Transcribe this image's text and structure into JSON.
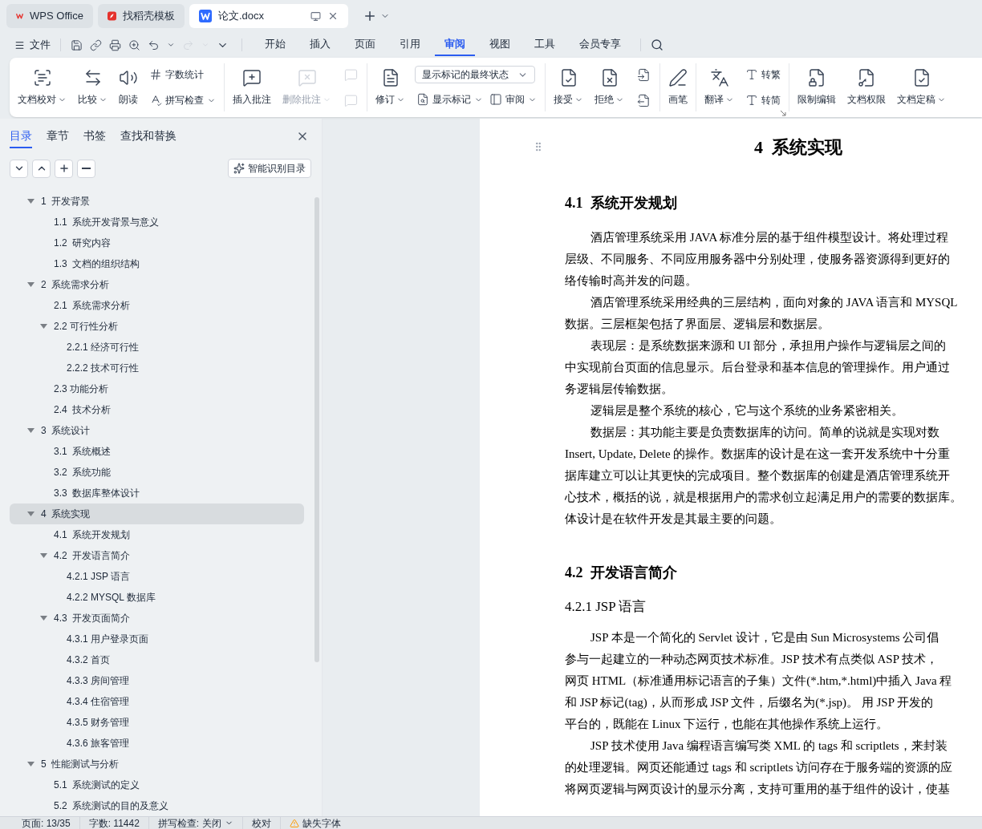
{
  "tabs": [
    {
      "label": "WPS Office",
      "selected": false,
      "kind": "wps"
    },
    {
      "label": "找稻壳模板",
      "selected": false,
      "kind": "docer"
    },
    {
      "label": "论文.docx",
      "selected": true,
      "kind": "doc"
    }
  ],
  "menu": {
    "file": "文件",
    "tabs": [
      {
        "label": "开始",
        "selected": false
      },
      {
        "label": "插入",
        "selected": false
      },
      {
        "label": "页面",
        "selected": false
      },
      {
        "label": "引用",
        "selected": false
      },
      {
        "label": "审阅",
        "selected": true
      },
      {
        "label": "视图",
        "selected": false
      },
      {
        "label": "工具",
        "selected": false
      },
      {
        "label": "会员专享",
        "selected": false
      }
    ]
  },
  "ribbon": [
    {
      "items": [
        {
          "kind": "large",
          "label": "文档校对",
          "menu": true,
          "disabled": false
        },
        {
          "kind": "large",
          "label": "比较",
          "menu": true,
          "disabled": false
        },
        {
          "kind": "large",
          "label": "朗读",
          "disabled": false
        },
        {
          "kind": "stack",
          "items": [
            {
              "kind": "small",
              "label": "字数统计",
              "disabled": false
            },
            {
              "kind": "small",
              "label": "拼写检查",
              "menu": true,
              "disabled": false
            }
          ]
        }
      ]
    },
    {
      "items": [
        {
          "kind": "large",
          "label": "插入批注",
          "disabled": false
        },
        {
          "kind": "large",
          "label": "删除批注",
          "menu": true,
          "disabled": true
        },
        {
          "kind": "stack",
          "items": [
            {
              "kind": "icon",
              "disabled": true
            },
            {
              "kind": "icon",
              "disabled": true
            }
          ]
        }
      ]
    },
    {
      "items": [
        {
          "kind": "large",
          "label": "修订",
          "menu": true,
          "disabled": false
        },
        {
          "kind": "stack",
          "items": [
            {
              "kind": "select",
              "value": "显示标记的最终状态"
            },
            {
              "kind": "row",
              "items": [
                {
                  "kind": "small",
                  "label": "显示标记",
                  "menu": true,
                  "disabled": false
                },
                {
                  "kind": "small",
                  "label": "审阅",
                  "menu": true,
                  "disabled": false
                }
              ]
            }
          ]
        }
      ]
    },
    {
      "items": [
        {
          "kind": "large",
          "label": "接受",
          "menu": true,
          "disabled": false
        },
        {
          "kind": "large",
          "label": "拒绝",
          "menu": true,
          "disabled": false
        },
        {
          "kind": "stack",
          "items": [
            {
              "kind": "icon",
              "disabled": false
            },
            {
              "kind": "icon",
              "disabled": false
            }
          ]
        }
      ]
    },
    {
      "items": [
        {
          "kind": "large",
          "label": "画笔",
          "disabled": false
        }
      ]
    },
    {
      "dialog_launcher": true,
      "items": [
        {
          "kind": "large",
          "label": "翻译",
          "menu": true,
          "disabled": false
        },
        {
          "kind": "stack",
          "items": [
            {
              "kind": "small",
              "label": "转繁",
              "disabled": false
            },
            {
              "kind": "small",
              "label": "转简",
              "disabled": false
            }
          ]
        }
      ]
    },
    {
      "items": [
        {
          "kind": "large",
          "label": "限制编辑",
          "disabled": false
        },
        {
          "kind": "large",
          "label": "文档权限",
          "disabled": false
        },
        {
          "kind": "large",
          "label": "文档定稿",
          "menu": true,
          "disabled": false
        }
      ]
    }
  ],
  "sidebar": {
    "tabs": [
      {
        "label": "目录",
        "selected": true
      },
      {
        "label": "章节",
        "selected": false
      },
      {
        "label": "书签",
        "selected": false
      },
      {
        "label": "查找和替换",
        "selected": false
      }
    ],
    "smart_button": "智能识别目录",
    "outline": [
      {
        "label": "1  开发背景",
        "selected": false,
        "expanded": true,
        "children": [
          {
            "label": "1.1  系统开发背景与意义",
            "selected": false
          },
          {
            "label": "1.2  研究内容",
            "selected": false
          },
          {
            "label": "1.3  文档的组织结构",
            "selected": false
          }
        ]
      },
      {
        "label": "2  系统需求分析",
        "selected": false,
        "expanded": true,
        "children": [
          {
            "label": "2.1  系统需求分析",
            "selected": false
          },
          {
            "label": "2.2 可行性分析",
            "selected": false,
            "expanded": true,
            "children": [
              {
                "label": "2.2.1 经济可行性",
                "selected": false
              },
              {
                "label": "2.2.2 技术可行性",
                "selected": false
              }
            ]
          },
          {
            "label": "2.3 功能分析",
            "selected": false
          },
          {
            "label": "2.4  技术分析",
            "selected": false
          }
        ]
      },
      {
        "label": "3  系统设计",
        "selected": false,
        "expanded": true,
        "children": [
          {
            "label": "3.1  系统概述",
            "selected": false
          },
          {
            "label": "3.2  系统功能",
            "selected": false
          },
          {
            "label": "3.3  数据库整体设计",
            "selected": false
          }
        ]
      },
      {
        "label": "4  系统实现",
        "selected": true,
        "expanded": true,
        "children": [
          {
            "label": "4.1  系统开发规划",
            "selected": false
          },
          {
            "label": "4.2  开发语言简介",
            "selected": false,
            "expanded": true,
            "children": [
              {
                "label": "4.2.1 JSP 语言",
                "selected": false
              },
              {
                "label": "4.2.2 MYSQL 数据库",
                "selected": false
              }
            ]
          },
          {
            "label": "4.3  开发页面简介",
            "selected": false,
            "expanded": true,
            "children": [
              {
                "label": "4.3.1 用户登录页面",
                "selected": false
              },
              {
                "label": "4.3.2 首页",
                "selected": false
              },
              {
                "label": "4.3.3 房间管理",
                "selected": false
              },
              {
                "label": "4.3.4 住宿管理",
                "selected": false
              },
              {
                "label": "4.3.5 财务管理",
                "selected": false
              },
              {
                "label": "4.3.6 旅客管理",
                "selected": false
              }
            ]
          }
        ]
      },
      {
        "label": "5  性能测试与分析",
        "selected": false,
        "expanded": true,
        "children": [
          {
            "label": "5.1  系统测试的定义",
            "selected": false
          },
          {
            "label": "5.2  系统测试的目的及意义",
            "selected": false
          }
        ]
      }
    ]
  },
  "document": {
    "blocks": [
      {
        "kind": "h1",
        "text": "4  系统实现"
      },
      {
        "kind": "h2",
        "text": "4.1  系统开发规划"
      },
      {
        "kind": "p",
        "lines": [
          "酒店管理系统采用 JAVA 标准分层的基于组件模型设计。将处理过程",
          "层级、不同服务、不同应用服务器中分别处理，使服务器资源得到更好的",
          "络传输时高并发的问题。"
        ]
      },
      {
        "kind": "p",
        "lines": [
          "酒店管理系统采用经典的三层结构，面向对象的 JAVA 语言和 MYSQL",
          "数据。三层框架包括了界面层、逻辑层和数据层。"
        ]
      },
      {
        "kind": "p",
        "lines": [
          "表现层：是系统数据来源和 UI 部分，承担用户操作与逻辑层之间的",
          "中实现前台页面的信息显示。后台登录和基本信息的管理操作。用户通过",
          "务逻辑层传输数据。"
        ]
      },
      {
        "kind": "p",
        "lines": [
          "逻辑层是整个系统的核心，它与这个系统的业务紧密相关。"
        ]
      },
      {
        "kind": "p",
        "lines": [
          "数据层：其功能主要是负责数据库的访问。简单的说就是实现对数",
          "Insert, Update, Delete 的操作。数据库的设计是在这一套开发系统中十分重",
          "据库建立可以让其更快的完成项目。整个数据库的创建是酒店管理系统开",
          "心技术，概括的说，就是根据用户的需求创立起满足用户的需要的数据库。",
          "体设计是在软件开发是其最主要的问题。"
        ]
      },
      {
        "kind": "h2",
        "text": "4.2  开发语言简介"
      },
      {
        "kind": "h3",
        "text": "4.2.1 JSP 语言"
      },
      {
        "kind": "p",
        "lines": [
          "JSP 本是一个简化的 Servlet 设计，它是由 Sun Microsystems 公司倡",
          "参与一起建立的一种动态网页技术标准。JSP 技术有点类似 ASP 技术，",
          "网页 HTML（标准通用标记语言的子集）文件(*.htm,*.html)中插入 Java 程",
          "和 JSP 标记(tag)，从而形成 JSP 文件，后缀名为(*.jsp)。 用 JSP 开发的",
          "平台的，既能在 Linux 下运行，也能在其他操作系统上运行。"
        ]
      },
      {
        "kind": "p",
        "lines": [
          "JSP 技术使用 Java 编程语言编写类 XML 的 tags 和 scriptlets，来封装",
          "的处理逻辑。网页还能通过 tags 和 scriptlets 访问存在于服务端的资源的应",
          "将网页逻辑与网页设计的显示分离，支持可重用的基于组件的设计，使基"
        ]
      }
    ]
  },
  "status_bar": [
    {
      "kind": "text",
      "text": "页面: 13/35"
    },
    {
      "kind": "text",
      "text": "字数: 11442"
    },
    {
      "kind": "menu",
      "text": "拼写检查: 关闭"
    },
    {
      "kind": "text",
      "text": "校对"
    },
    {
      "kind": "warning",
      "text": "缺失字体"
    }
  ]
}
